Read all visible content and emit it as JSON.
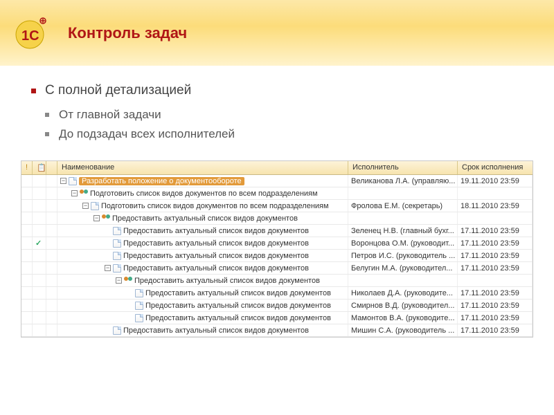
{
  "header": {
    "title": "Контроль задач"
  },
  "bullets": {
    "main": "С полной детализацией",
    "subs": [
      "От главной задачи",
      "До подзадач всех исполнителей"
    ]
  },
  "grid": {
    "columns": {
      "flag": "!",
      "name": "Наименование",
      "executor": "Исполнитель",
      "due": "Срок исполнения"
    },
    "rows": [
      {
        "indent": 0,
        "toggle": "-",
        "icon": "doc",
        "selected": true,
        "checked": false,
        "name": "Разработать положение о документообороте",
        "executor": "Великанова Л.А. (управляю...",
        "due": "19.11.2010 23:59"
      },
      {
        "indent": 1,
        "toggle": "-",
        "icon": "users",
        "selected": false,
        "checked": false,
        "name": "Подготовить список видов документов по всем подразделениям",
        "executor": "",
        "due": ""
      },
      {
        "indent": 2,
        "toggle": "-",
        "icon": "doc",
        "selected": false,
        "checked": false,
        "name": "Подготовить список видов документов по всем подразделениям",
        "executor": "Фролова Е.М. (секретарь)",
        "due": "18.11.2010 23:59"
      },
      {
        "indent": 3,
        "toggle": "-",
        "icon": "users",
        "selected": false,
        "checked": false,
        "name": "Предоставить актуальный список видов документов",
        "executor": "",
        "due": ""
      },
      {
        "indent": 4,
        "toggle": "",
        "icon": "doc",
        "selected": false,
        "checked": false,
        "name": "Предоставить актуальный список видов документов",
        "executor": "Зеленец Н.В. (главный бухг...",
        "due": "17.11.2010 23:59"
      },
      {
        "indent": 4,
        "toggle": "",
        "icon": "doc",
        "selected": false,
        "checked": true,
        "name": "Предоставить актуальный список видов документов",
        "executor": "Воронцова О.М. (руководит...",
        "due": "17.11.2010 23:59"
      },
      {
        "indent": 4,
        "toggle": "",
        "icon": "doc",
        "selected": false,
        "checked": false,
        "name": "Предоставить актуальный список видов документов",
        "executor": "Петров И.С. (руководитель ...",
        "due": "17.11.2010 23:59"
      },
      {
        "indent": 4,
        "toggle": "-",
        "icon": "doc",
        "selected": false,
        "checked": false,
        "name": "Предоставить актуальный список видов документов",
        "executor": "Белугин М.А. (руководител...",
        "due": "17.11.2010 23:59"
      },
      {
        "indent": 5,
        "toggle": "-",
        "icon": "users",
        "selected": false,
        "checked": false,
        "name": "Предоставить актуальный список видов документов",
        "executor": "",
        "due": ""
      },
      {
        "indent": 6,
        "toggle": "",
        "icon": "doc",
        "selected": false,
        "checked": false,
        "name": "Предоставить актуальный список видов документов",
        "executor": "Николаев Д.А. (руководите...",
        "due": "17.11.2010 23:59"
      },
      {
        "indent": 6,
        "toggle": "",
        "icon": "doc",
        "selected": false,
        "checked": false,
        "name": "Предоставить актуальный список видов документов",
        "executor": "Смирнов В.Д. (руководител...",
        "due": "17.11.2010 23:59"
      },
      {
        "indent": 6,
        "toggle": "",
        "icon": "doc",
        "selected": false,
        "checked": false,
        "name": "Предоставить актуальный список видов документов",
        "executor": "Мамонтов В.А. (руководите...",
        "due": "17.11.2010 23:59"
      },
      {
        "indent": 4,
        "toggle": "",
        "icon": "doc",
        "selected": false,
        "checked": false,
        "name": "Предоставить актуальный список видов документов",
        "executor": "Мишин С.А. (руководитель ...",
        "due": "17.11.2010 23:59"
      }
    ]
  }
}
